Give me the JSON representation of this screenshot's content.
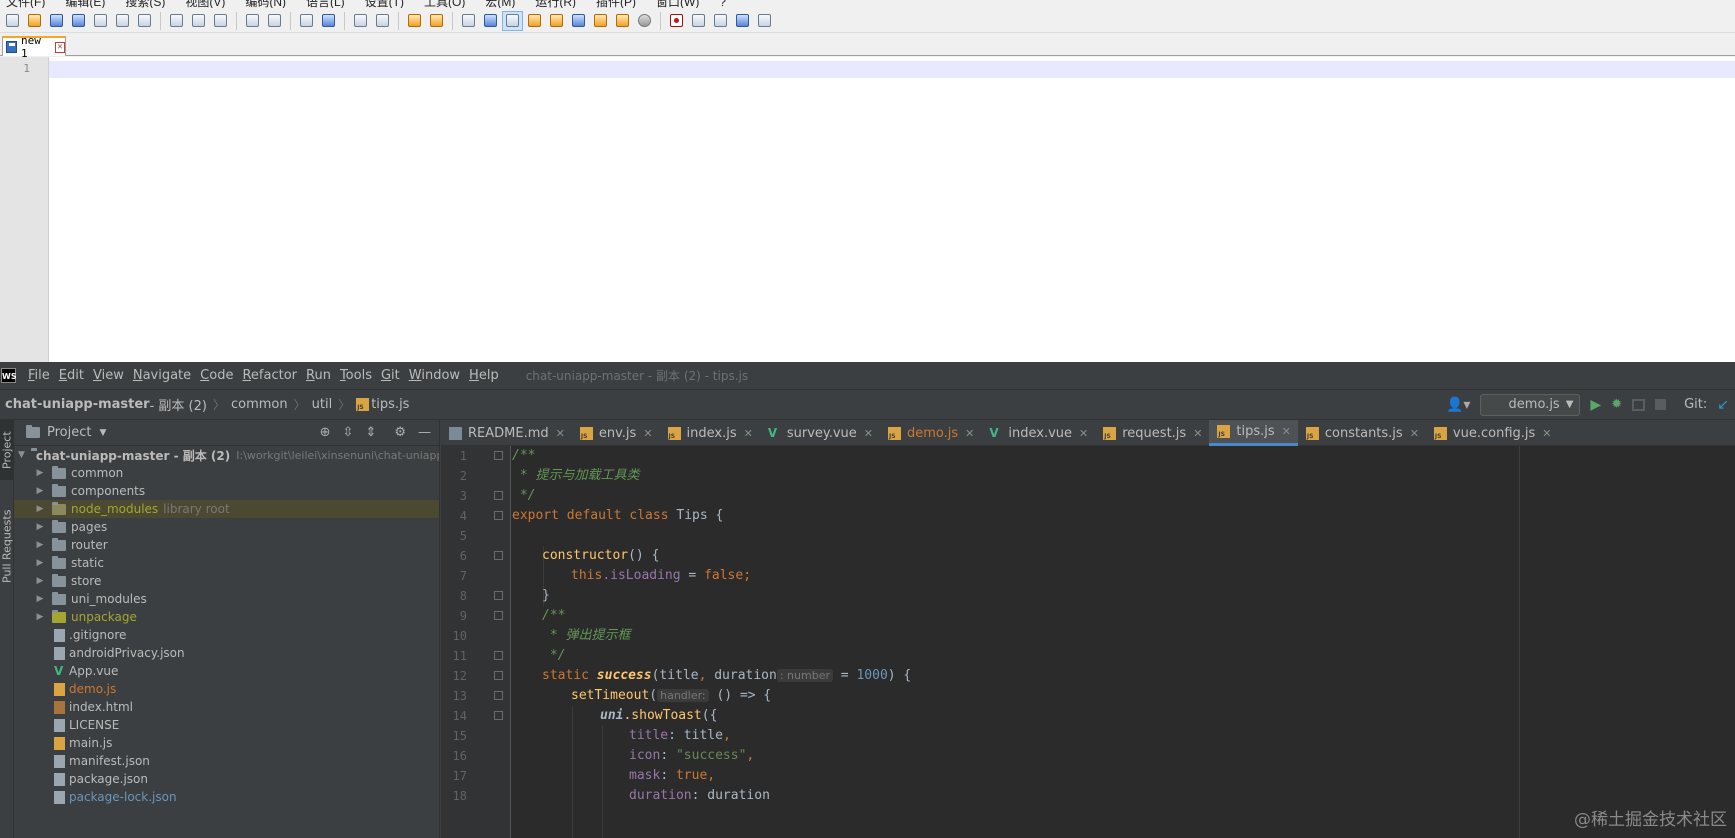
{
  "notepad": {
    "menu": [
      "文件(F)",
      "编辑(E)",
      "搜索(S)",
      "视图(V)",
      "编码(N)",
      "语言(L)",
      "设置(T)",
      "工具(O)",
      "宏(M)",
      "运行(R)",
      "插件(P)",
      "窗口(W)",
      "?"
    ],
    "tab_label": "new 1",
    "line_number": "1"
  },
  "ide": {
    "logo": "WS",
    "menu": [
      "File",
      "Edit",
      "View",
      "Navigate",
      "Code",
      "Refactor",
      "Run",
      "Tools",
      "Git",
      "Window",
      "Help"
    ],
    "window_title": "chat-uniapp-master - 副本 (2) - tips.js",
    "breadcrumb": {
      "project": "chat-uniapp-master",
      "project_suffix": " - 副本 (2)",
      "items": [
        "common",
        "util",
        "tips.js"
      ]
    },
    "run_config": "demo.js",
    "git_label": "Git:",
    "side_tabs": {
      "project": "Project",
      "pull_requests": "Pull Requests"
    },
    "project_panel": {
      "title": "Project",
      "root_name": "chat-uniapp-master - 副本 (2)",
      "root_path": "I:\\workgit\\leilei\\xinsenuni\\chat-uniapp-ma",
      "folders": [
        "common",
        "components",
        "node_modules",
        "pages",
        "router",
        "static",
        "store",
        "uni_modules",
        "unpackage"
      ],
      "node_modules_hint": "library root",
      "files": [
        ".gitignore",
        "androidPrivacy.json",
        "App.vue",
        "demo.js",
        "index.html",
        "LICENSE",
        "main.js",
        "manifest.json",
        "package.json",
        "package-lock.json"
      ]
    },
    "tabs": [
      "README.md",
      "env.js",
      "index.js",
      "survey.vue",
      "demo.js",
      "index.vue",
      "request.js",
      "tips.js",
      "constants.js",
      "vue.config.js"
    ],
    "active_tab": "tips.js",
    "line_numbers": [
      "1",
      "2",
      "3",
      "4",
      "5",
      "6",
      "7",
      "8",
      "9",
      "10",
      "11",
      "12",
      "13",
      "14",
      "15",
      "16",
      "17",
      "18"
    ],
    "code": {
      "l1": "/**",
      "l2": " * 提示与加载工具类",
      "l3": " */",
      "l4_kw": "export default class ",
      "l4_cls": "Tips",
      "l4_end": " {",
      "l6_fn": "constructor",
      "l6_end": "() {",
      "l7_this": "this",
      "l7_prop": ".isLoading",
      "l7_eq": " = ",
      "l7_val": "false",
      "l7_end": ";",
      "l8": "}",
      "l9": "/**",
      "l10": " * 弹出提示框",
      "l11": " */",
      "l12_kw": "static ",
      "l12_fn": "success",
      "l12_open": "(title",
      "l12_comma": ", ",
      "l12_param": "duration",
      "l12_hint": ": number",
      "l12_eq": " = ",
      "l12_num": "1000",
      "l12_end": ") {",
      "l13_fn": "setTimeout",
      "l13_open": "(",
      "l13_hint": "handler:",
      "l13_end": " () => {",
      "l14_obj": "uni",
      "l14_fn": ".showToast",
      "l14_end": "({",
      "l15_key": "title",
      "l15_val": ": title",
      "l15_end": ",",
      "l16_key": "icon",
      "l16_colon": ": ",
      "l16_str": "\"success\"",
      "l16_end": ",",
      "l17_key": "mask",
      "l17_colon": ": ",
      "l17_val": "true",
      "l17_end": ",",
      "l18_key": "duration",
      "l18_val": ": duration"
    }
  },
  "watermark": "@稀土掘金技术社区"
}
